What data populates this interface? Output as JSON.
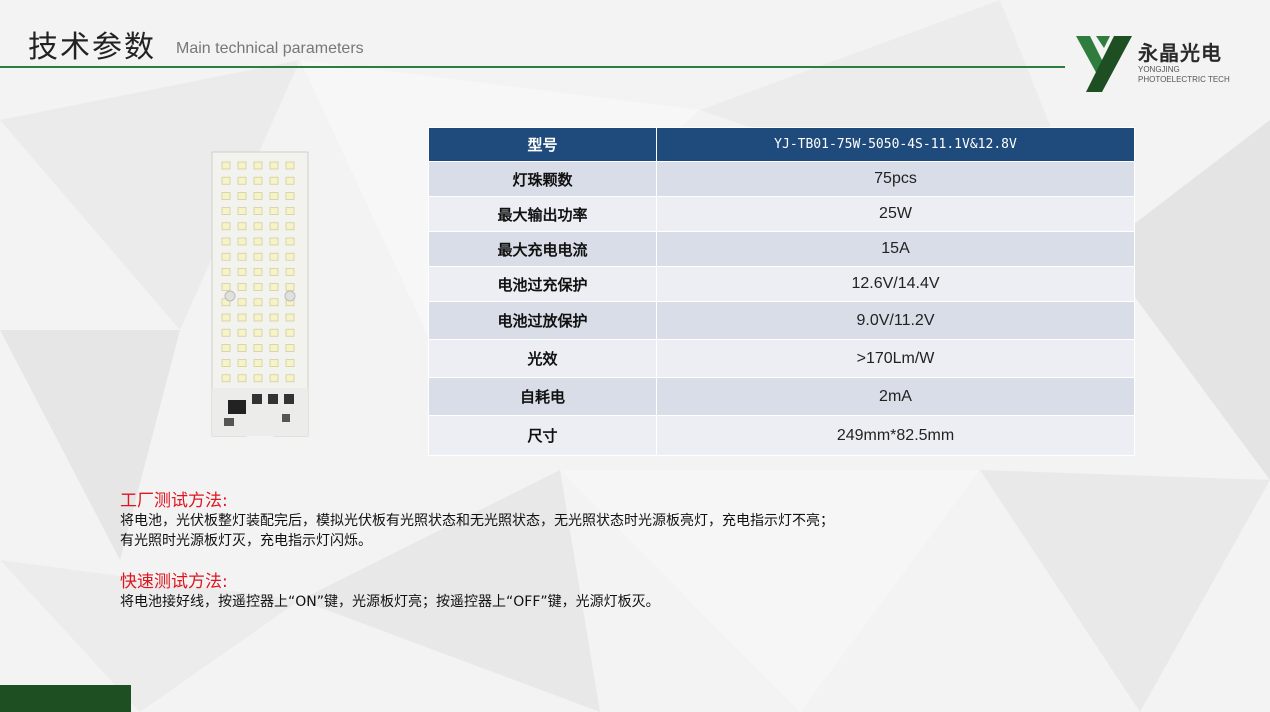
{
  "header": {
    "title_cn": "技术参数",
    "title_en": "Main technical parameters"
  },
  "logo": {
    "name_cn": "永晶光电",
    "name_en": "YONGJING PHOTOELECTRIC TECH",
    "colors": {
      "primary": "#2f7d3e",
      "dark": "#1d4f23"
    }
  },
  "spec_table": {
    "header": {
      "label": "型号",
      "value": "YJ-TB01-75W-5050-4S-11.1V&12.8V"
    },
    "rows": [
      {
        "label": "灯珠颗数",
        "value": "75pcs"
      },
      {
        "label": "最大输出功率",
        "value": "25W"
      },
      {
        "label": "最大充电电流",
        "value": "15A"
      },
      {
        "label": "电池过充保护",
        "value": "12.6V/14.4V"
      },
      {
        "label": "电池过放保护",
        "value": "9.0V/11.2V"
      },
      {
        "label": "光效",
        "value": ">170Lm/W"
      },
      {
        "label": "自耗电",
        "value": "2mA"
      },
      {
        "label": "尺寸",
        "value": "249mm*82.5mm"
      }
    ],
    "colors": {
      "header": "#1f4a7c",
      "row_odd": "#d8dde8",
      "row_even": "#eceef3"
    }
  },
  "factory_test": {
    "heading": "工厂测试方法:",
    "line1": "将电池，光伏板整灯装配完后，模拟光伏板有光照状态和无光照状态，无光照状态时光源板亮灯，充电指示灯不亮；",
    "line2": "有光照时光源板灯灭，充电指示灯闪烁。"
  },
  "quick_test": {
    "heading": "快速测试方法:",
    "line1": "将电池接好线，按遥控器上“ON”键，光源板灯亮；按遥控器上“OFF”键，光源灯板灭。"
  },
  "accent_color": "#e0141e"
}
